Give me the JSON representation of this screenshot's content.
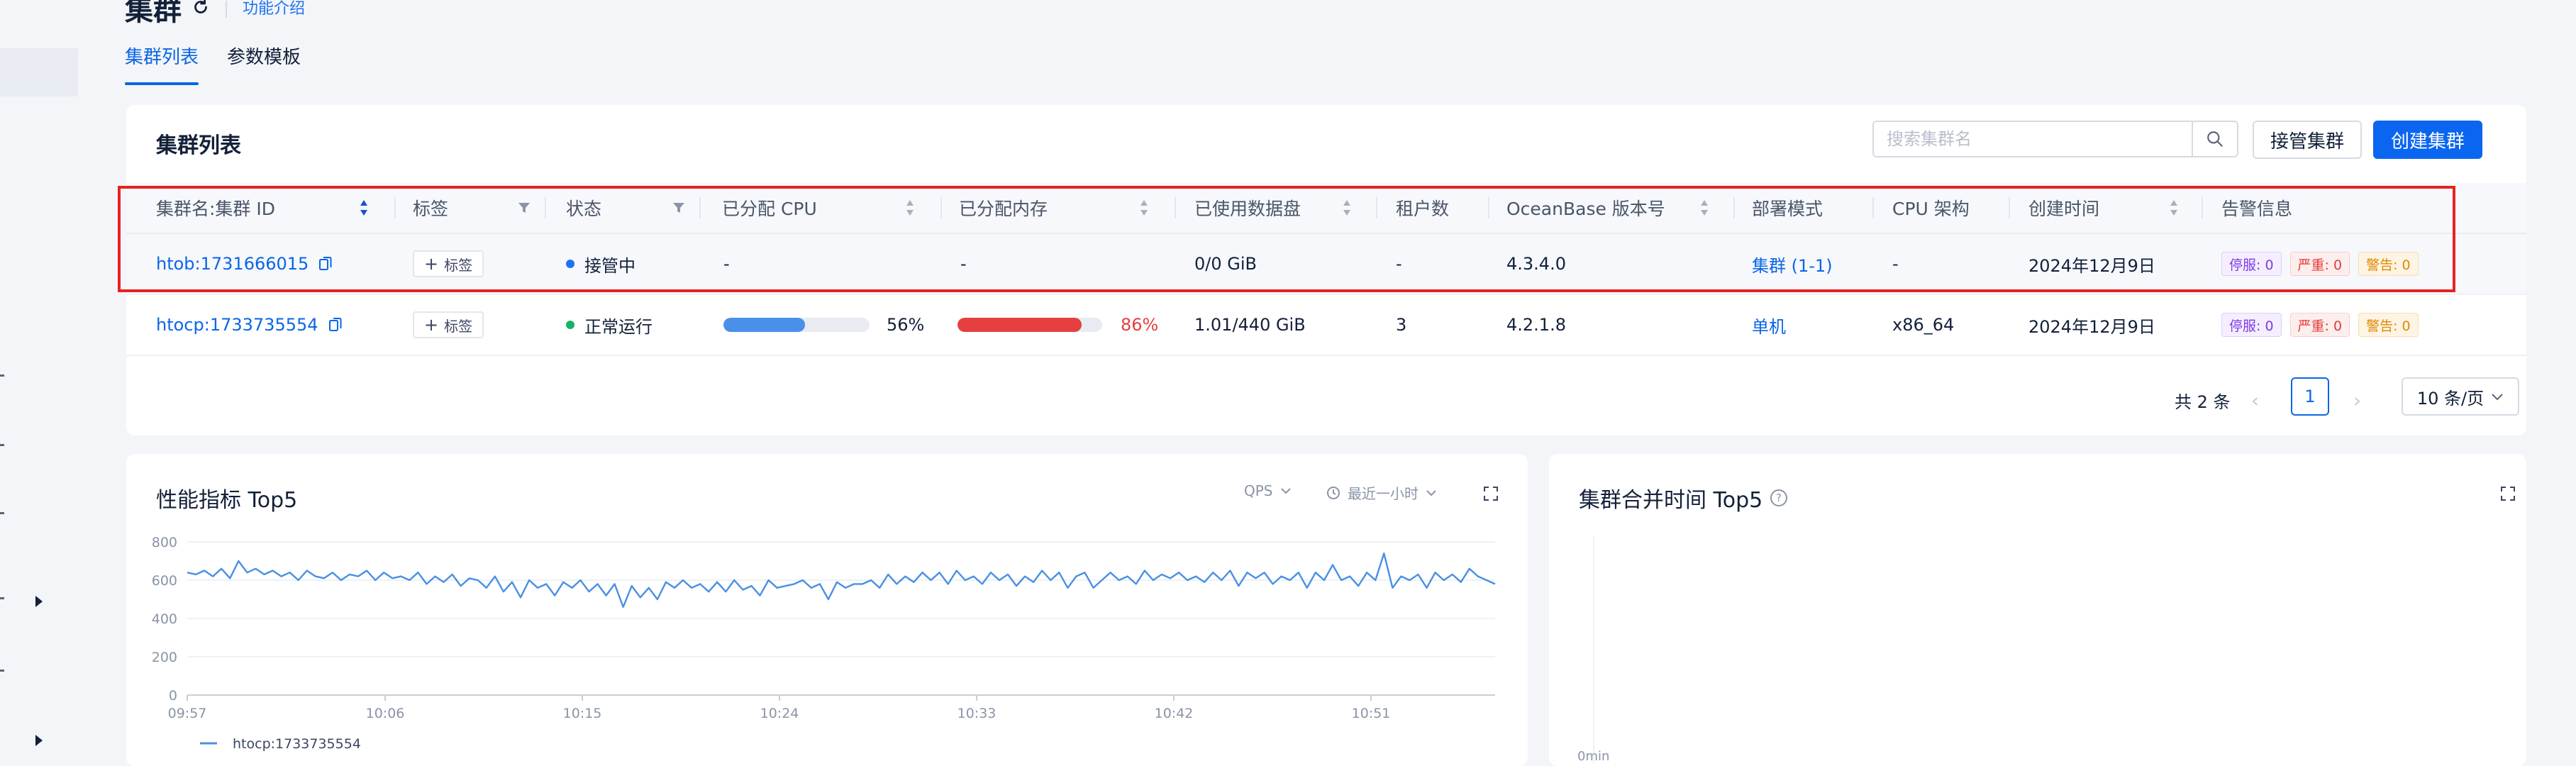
{
  "page": {
    "title": "集群",
    "help_link": "功能介绍",
    "tabs": [
      {
        "label": "集群列表",
        "active": true
      },
      {
        "label": "参数模板",
        "active": false
      }
    ]
  },
  "cluster_card": {
    "title": "集群列表",
    "search_placeholder": "搜索集群名",
    "takeover_button": "接管集群",
    "create_button": "创建集群",
    "columns": [
      "集群名:集群 ID",
      "标签",
      "状态",
      "已分配 CPU",
      "已分配内存",
      "已使用数据盘",
      "租户数",
      "OceanBase 版本号",
      "部署模式",
      "CPU 架构",
      "创建时间",
      "告警信息"
    ],
    "rows": [
      {
        "name": "htob:1731666015",
        "tag_button": "标签",
        "status": "接管中",
        "status_color": "#1d72f3",
        "cpu_text": "-",
        "memory_text": "-",
        "disk": "0/0 GiB",
        "tenants": "-",
        "version": "4.3.4.0",
        "deploy_mode": "集群 (1-1)",
        "cpu_arch": "-",
        "created": "2024年12月9日",
        "alerts": {
          "stop": "停服: 0",
          "severe": "严重: 0",
          "warn": "警告: 0"
        }
      },
      {
        "name": "htocp:1733735554",
        "tag_button": "标签",
        "status": "正常运行",
        "status_color": "#17b26a",
        "cpu_pct": 56,
        "cpu_text": "56%",
        "memory_pct": 86,
        "memory_text": "86%",
        "disk": "1.01/440 GiB",
        "tenants": "3",
        "version": "4.2.1.8",
        "deploy_mode": "单机",
        "cpu_arch": "x86_64",
        "created": "2024年12月9日",
        "alerts": {
          "stop": "停服: 0",
          "severe": "严重: 0",
          "warn": "警告: 0"
        }
      }
    ],
    "pagination": {
      "total": "共 2 条",
      "current": "1",
      "page_size": "10 条/页"
    }
  },
  "perf_card": {
    "title": "性能指标 Top5",
    "metric_select": "QPS",
    "time_select": "最近一小时"
  },
  "merge_card": {
    "title": "集群合并时间 Top5",
    "axis_hint": "0min"
  },
  "chart_data": {
    "type": "line",
    "ylim": [
      0,
      800
    ],
    "yticks": [
      "800",
      "600",
      "400",
      "200",
      "0"
    ],
    "xticks": [
      "09:57",
      "10:06",
      "10:15",
      "10:24",
      "10:33",
      "10:42",
      "10:51"
    ],
    "series": [
      {
        "name": "htocp:1733735554",
        "color": "#4a90e2",
        "values": [
          640,
          630,
          650,
          620,
          660,
          610,
          700,
          640,
          660,
          630,
          650,
          620,
          640,
          600,
          650,
          620,
          610,
          640,
          600,
          630,
          620,
          650,
          600,
          640,
          610,
          620,
          600,
          640,
          580,
          620,
          590,
          630,
          570,
          610,
          600,
          560,
          620,
          540,
          590,
          510,
          600,
          560,
          580,
          520,
          590,
          560,
          600,
          540,
          580,
          520,
          580,
          460,
          570,
          510,
          560,
          500,
          590,
          560,
          600,
          560,
          580,
          540,
          590,
          540,
          600,
          550,
          570,
          520,
          600,
          560,
          570,
          580,
          600,
          560,
          580,
          500,
          590,
          560,
          580,
          580,
          600,
          560,
          630,
          580,
          620,
          590,
          640,
          600,
          640,
          580,
          650,
          600,
          620,
          580,
          640,
          600,
          630,
          570,
          620,
          590,
          650,
          600,
          640,
          560,
          620,
          640,
          560,
          600,
          640,
          600,
          620,
          580,
          650,
          600,
          630,
          610,
          640,
          600,
          620,
          590,
          640,
          600,
          650,
          570,
          640,
          610,
          640,
          580,
          620,
          600,
          640,
          560,
          640,
          600,
          680,
          600,
          620,
          570,
          640,
          600,
          740,
          560,
          620,
          600,
          630,
          560,
          640,
          600,
          630,
          590,
          660,
          620,
          600,
          580
        ]
      }
    ]
  }
}
